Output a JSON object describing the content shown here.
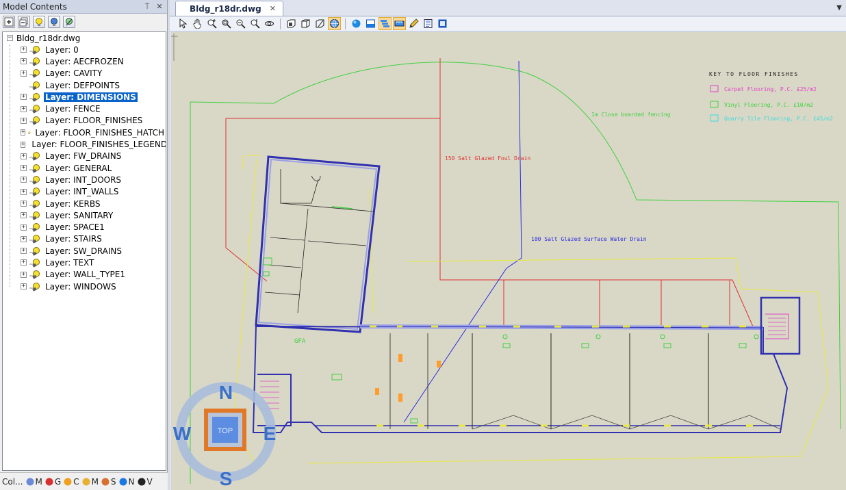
{
  "panel": {
    "title": "Model Contents",
    "pin_glyph": "⍑",
    "close_glyph": "✕"
  },
  "tree": {
    "root": "Bldg_r18dr.dwg",
    "layers": [
      {
        "label": "Layer: 0",
        "expandable": true,
        "selected": false
      },
      {
        "label": "Layer: AECFROZEN",
        "expandable": true,
        "selected": false
      },
      {
        "label": "Layer: CAVITY",
        "expandable": true,
        "selected": false
      },
      {
        "label": "Layer: DEFPOINTS",
        "expandable": false,
        "selected": false
      },
      {
        "label": "Layer: DIMENSIONS",
        "expandable": true,
        "selected": true
      },
      {
        "label": "Layer: FENCE",
        "expandable": true,
        "selected": false
      },
      {
        "label": "Layer: FLOOR_FINISHES",
        "expandable": true,
        "selected": false
      },
      {
        "label": "Layer: FLOOR_FINISHES_HATCH",
        "expandable": true,
        "selected": false
      },
      {
        "label": "Layer: FLOOR_FINISHES_LEGEND",
        "expandable": true,
        "selected": false
      },
      {
        "label": "Layer: FW_DRAINS",
        "expandable": true,
        "selected": false
      },
      {
        "label": "Layer: GENERAL",
        "expandable": true,
        "selected": false
      },
      {
        "label": "Layer: INT_DOORS",
        "expandable": true,
        "selected": false
      },
      {
        "label": "Layer: INT_WALLS",
        "expandable": true,
        "selected": false
      },
      {
        "label": "Layer: KERBS",
        "expandable": true,
        "selected": false
      },
      {
        "label": "Layer: SANITARY",
        "expandable": true,
        "selected": false
      },
      {
        "label": "Layer: SPACE1",
        "expandable": true,
        "selected": false
      },
      {
        "label": "Layer: STAIRS",
        "expandable": true,
        "selected": false
      },
      {
        "label": "Layer: SW_DRAINS",
        "expandable": true,
        "selected": false
      },
      {
        "label": "Layer: TEXT",
        "expandable": true,
        "selected": false
      },
      {
        "label": "Layer: WALL_TYPE1",
        "expandable": true,
        "selected": false
      },
      {
        "label": "Layer: WINDOWS",
        "expandable": true,
        "selected": false
      }
    ]
  },
  "footer_tabs": [
    {
      "label": "Col...",
      "icon": "collapse-icon"
    },
    {
      "label": "M",
      "icon": "model-icon"
    },
    {
      "label": "G",
      "icon": "grid-icon"
    },
    {
      "label": "C",
      "icon": "light-icon"
    },
    {
      "label": "M",
      "icon": "markup-icon"
    },
    {
      "label": "S",
      "icon": "section-icon"
    },
    {
      "label": "N",
      "icon": "info-icon"
    },
    {
      "label": "V",
      "icon": "view-icon"
    }
  ],
  "document": {
    "tab_label": "Bldg_r18dr.dwg",
    "tab_close": "✕",
    "dropdown_glyph": "▼"
  },
  "drawing": {
    "legend_title": "KEY TO FLOOR FINISHES",
    "legend_items": [
      {
        "label": "Carpet Flooring, P.C. £25/m2",
        "color": "#e040c8"
      },
      {
        "label": "Vinyl Flooring, P.C. £10/m2",
        "color": "#3fcf3f"
      },
      {
        "label": "Quarry Tile Flooring, P.C. £45/m2",
        "color": "#40d8e0"
      }
    ],
    "fence_note": "1m Close boarded fencing",
    "foul_drain": "150 Salt Glazed Foul Drain",
    "surface_drain": "100 Salt Glazed Surface Water Drain",
    "gfa": "GFA",
    "colors": {
      "fence": "#3fcf3f",
      "foul": "#e03030",
      "surface": "#2a2ae0",
      "kerb": "#e8e840",
      "wall": "#3030b0",
      "wall_fill": "#9aa0e8"
    }
  },
  "compass": {
    "n": "N",
    "s": "S",
    "e": "E",
    "w": "W",
    "top": "TOP"
  }
}
